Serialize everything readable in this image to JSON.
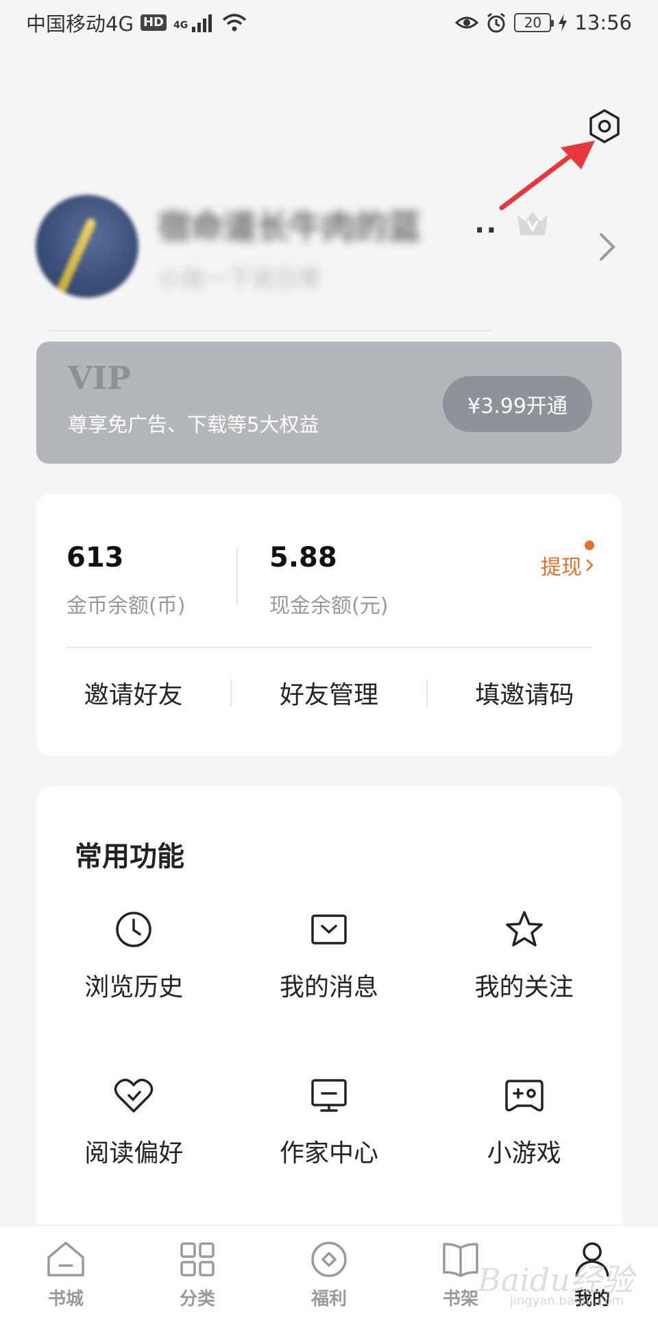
{
  "status_bar": {
    "carrier": "中国移动4G",
    "hd": "HD",
    "network": "4G",
    "battery": "20",
    "time": "13:56"
  },
  "settings": {
    "icon": "gear-icon"
  },
  "profile": {
    "name": "宿命道长牛肉的蓝",
    "name_ellipsis": "..",
    "subtitle": "小说一下说日常",
    "vip_badge_icon": "crown-icon"
  },
  "vip": {
    "title": "VIP",
    "description": "尊享免广告、下载等5大权益",
    "button": "¥3.99开通"
  },
  "wallet": {
    "coins_value": "613",
    "coins_label": "金币余额(币)",
    "cash_value": "5.88",
    "cash_label": "现金余额(元)",
    "withdraw": "提现",
    "actions": [
      "邀请好友",
      "好友管理",
      "填邀请码"
    ]
  },
  "functions": {
    "title": "常用功能",
    "items": [
      {
        "label": "浏览历史",
        "icon": "clock-icon"
      },
      {
        "label": "我的消息",
        "icon": "message-icon"
      },
      {
        "label": "我的关注",
        "icon": "star-icon"
      },
      {
        "label": "阅读偏好",
        "icon": "heart-icon"
      },
      {
        "label": "作家中心",
        "icon": "monitor-icon"
      },
      {
        "label": "小游戏",
        "icon": "gamepad-icon"
      }
    ]
  },
  "nav": {
    "items": [
      {
        "label": "书城",
        "icon": "home-icon"
      },
      {
        "label": "分类",
        "icon": "grid-icon"
      },
      {
        "label": "福利",
        "icon": "gift-icon"
      },
      {
        "label": "书架",
        "icon": "book-icon"
      },
      {
        "label": "我的",
        "icon": "user-icon",
        "active": true
      }
    ]
  },
  "watermark": {
    "text": "Baidu经验",
    "sub": "jingyan.baidu.com"
  },
  "colors": {
    "accent": "#e8702a",
    "vip_card": "#b3b6ba",
    "vip_button": "#8e9399",
    "annotation_arrow": "#e8363a"
  }
}
